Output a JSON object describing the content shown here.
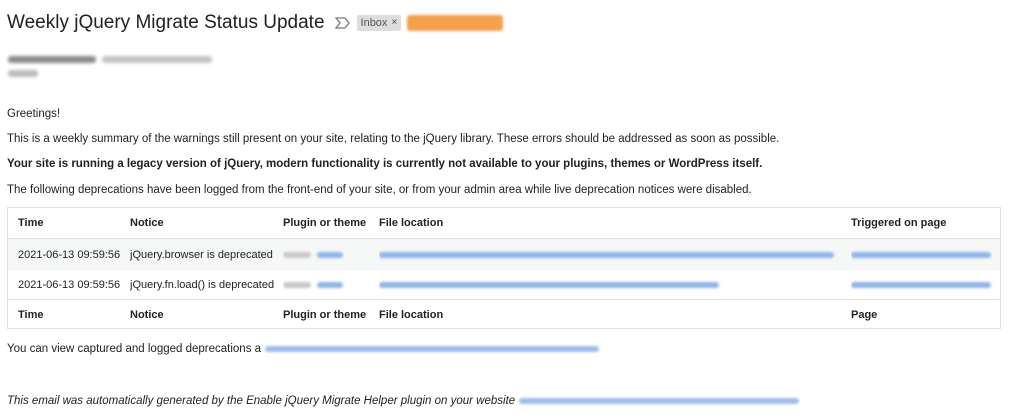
{
  "email": {
    "subject": "Weekly jQuery Migrate Status Update",
    "inbox_label": "Inbox",
    "chip_close": "×",
    "label_color": "#f4a14a",
    "important_icon": "important-marker-icon"
  },
  "body": {
    "greeting": "Greetings!",
    "summary": "This is a weekly summary of the warnings still present on your site, relating to the jQuery library. These errors should be addressed as soon as possible.",
    "legacy_notice": "Your site is running a legacy version of jQuery, modern functionality is currently not available to your plugins, themes or WordPress itself.",
    "deprecations_intro": "The following deprecations have been logged from the front-end of your site, or from your admin area while live deprecation notices were disabled.",
    "view_logged_prefix": "You can view captured and logged deprecations a",
    "footer_prefix": "This email was automatically generated by the Enable jQuery Migrate Helper plugin on your website"
  },
  "table": {
    "headers": [
      "Time",
      "Notice",
      "Plugin or theme",
      "File location",
      "Triggered on page"
    ],
    "footers": [
      "Time",
      "Notice",
      "Plugin or theme",
      "File location",
      "Page"
    ],
    "rows": [
      {
        "time": "2021-06-13 09:59:56",
        "notice": "jQuery.browser is deprecated"
      },
      {
        "time": "2021-06-13 09:59:56",
        "notice": "jQuery.fn.load() is deprecated"
      }
    ]
  },
  "colors": {
    "link": "#1a73e8",
    "row_stripe": "#f6f7f7",
    "border": "#e1e1e1"
  }
}
